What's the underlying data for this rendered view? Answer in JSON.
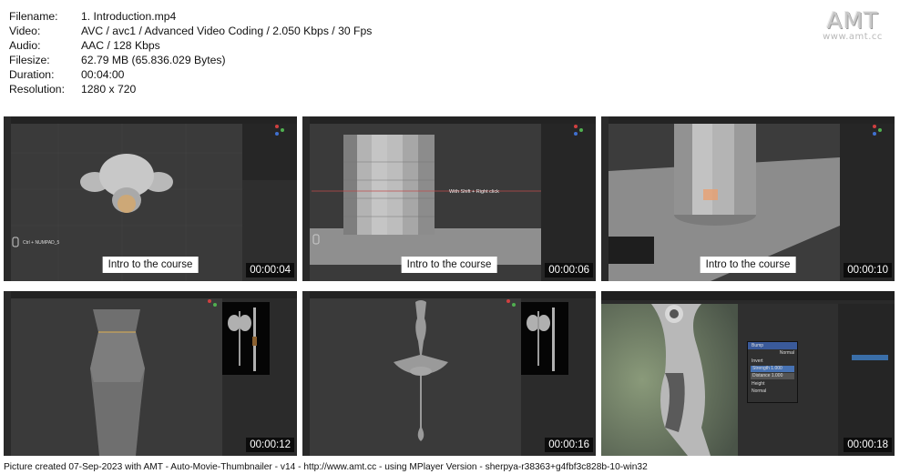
{
  "info": [
    {
      "label": "Filename:",
      "value": "1. Introduction.mp4"
    },
    {
      "label": "Video:",
      "value": "AVC / avc1 / Advanced Video Coding / 2.050 Kbps / 30 Fps"
    },
    {
      "label": "Audio:",
      "value": "AAC / 128 Kbps"
    },
    {
      "label": "Filesize:",
      "value": "62.79 MB (65.836.029 Bytes)"
    },
    {
      "label": "Duration:",
      "value": "00:04:00"
    },
    {
      "label": "Resolution:",
      "value": "1280 x 720"
    }
  ],
  "logo": {
    "text": "AMT",
    "url": "www.amt.cc"
  },
  "thumbnails": [
    {
      "caption": "Intro to the course",
      "time": "00:00:04",
      "overlay": "Ctrl + NUMPAD_5"
    },
    {
      "caption": "Intro to the course",
      "time": "00:00:06",
      "overlay": "With Shift + Right click"
    },
    {
      "caption": "Intro to the course",
      "time": "00:00:10"
    },
    {
      "time": "00:00:12"
    },
    {
      "time": "00:00:16"
    },
    {
      "time": "00:00:18",
      "node": {
        "title": "Bump",
        "output": "Normal",
        "invert": "Invert",
        "strength": "Strength  1.000",
        "distance": "Distance  1.000",
        "height": "Height",
        "normal_in": "Normal"
      }
    }
  ],
  "footer": "Picture created 07-Sep-2023 with AMT - Auto-Movie-Thumbnailer - v14 - http://www.amt.cc - using MPlayer Version - sherpya-r38363+g4fbf3c828b-10-win32"
}
